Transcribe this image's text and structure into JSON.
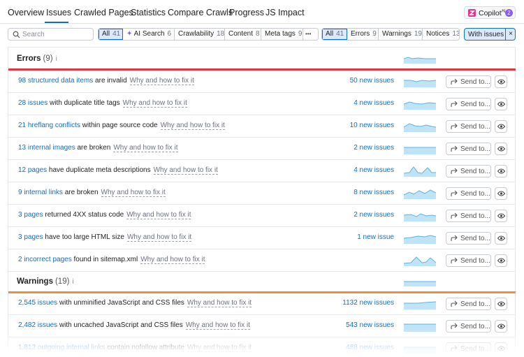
{
  "nav": {
    "tabs": [
      {
        "label": "Overview"
      },
      {
        "label": "Issues"
      },
      {
        "label": "Crawled Pages"
      },
      {
        "label": "Statistics"
      },
      {
        "label": "Compare Crawls"
      },
      {
        "label": "Progress"
      },
      {
        "label": "JS Impact"
      }
    ],
    "active_tab": "Issues",
    "copilot": {
      "label": "Copilot",
      "superscript": "AI",
      "count": "2"
    }
  },
  "search": {
    "placeholder": "Search",
    "value": ""
  },
  "category_filters": [
    {
      "label": "All",
      "count": "41",
      "selected": true
    },
    {
      "label": "AI Search",
      "count": "6",
      "selected": false
    },
    {
      "label": "Crawlability",
      "count": "18",
      "selected": false
    },
    {
      "label": "Content",
      "count": "8",
      "selected": false
    },
    {
      "label": "Meta tags",
      "count": "9",
      "selected": false
    }
  ],
  "more_label": "•••",
  "type_filters": [
    {
      "label": "All",
      "count": "41",
      "selected": true
    },
    {
      "label": "Errors",
      "count": "9",
      "selected": false
    },
    {
      "label": "Warnings",
      "count": "19",
      "selected": false
    },
    {
      "label": "Notices",
      "count": "13",
      "selected": false
    }
  ],
  "with_issues": {
    "label": "With issues",
    "close": "×"
  },
  "colors": {
    "accent": "#0b6fd1",
    "errors": "#e0383e",
    "warnings": "#f08c3a",
    "spark_fill": "#bfe3f7",
    "spark_line": "#5bb4e5"
  },
  "why_label": "Why and how to fix it",
  "send_label": "Send to...",
  "sections": [
    {
      "title": "Errors",
      "count": "(9)",
      "info": "i",
      "issues": [
        {
          "link": "98 structured data items",
          "text": " are invalid",
          "new": "50 new issues"
        },
        {
          "link": "28 issues",
          "text": " with duplicate title tags",
          "new": "4 new issues"
        },
        {
          "link": "21 hreflang conflicts",
          "text": " within page source code",
          "new": "10 new issues"
        },
        {
          "link": "13 internal images",
          "text": " are broken",
          "new": "2 new issues"
        },
        {
          "link": "12 pages",
          "text": " have duplicate meta descriptions",
          "new": "4 new issues"
        },
        {
          "link": "9 internal links",
          "text": " are broken",
          "new": "8 new issues"
        },
        {
          "link": "3 pages",
          "text": " returned 4XX status code",
          "new": "2 new issues"
        },
        {
          "link": "3 pages",
          "text": " have too large HTML size",
          "new": "1 new issue"
        },
        {
          "link": "2 incorrect pages",
          "text": " found in sitemap.xml",
          "new": ""
        }
      ]
    },
    {
      "title": "Warnings",
      "count": "(19)",
      "info": "i",
      "issues": [
        {
          "link": "2,545 issues",
          "text": " with unminified JavaScript and CSS files",
          "new": "1132 new issues"
        },
        {
          "link": "2,482 issues",
          "text": " with uncached JavaScript and CSS files",
          "new": "543 new issues"
        },
        {
          "link": "1,812 outgoing internal links",
          "text": " contain nofollow attribute",
          "new": "488 new issues"
        }
      ]
    }
  ]
}
